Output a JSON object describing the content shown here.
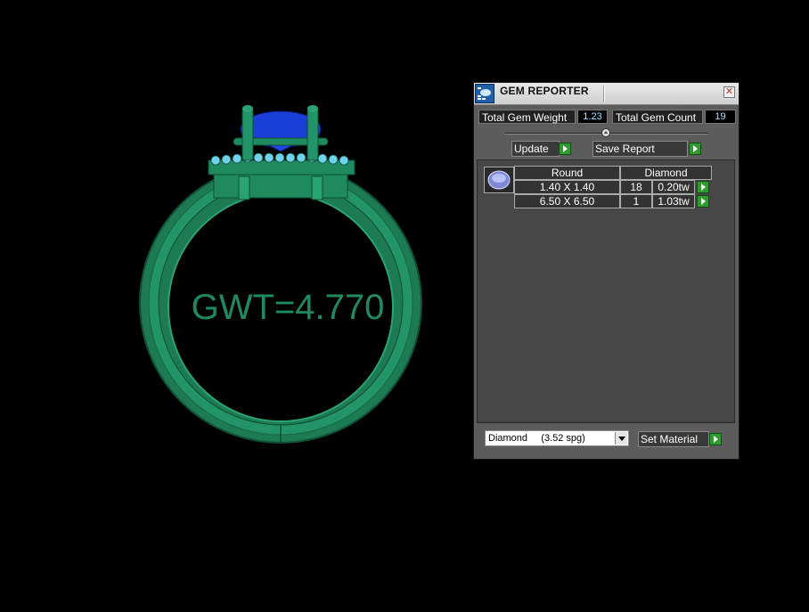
{
  "viewport": {
    "gwt_text": "GWT=4.770",
    "ring_color": "#1f8a60",
    "stone_color": "#1a3fd6",
    "accent_stone_color": "#6fd3f0"
  },
  "panel": {
    "title": "GEM REPORTER",
    "close_icon": "close-icon",
    "total_gem_weight_label": "Total Gem Weight",
    "total_gem_weight_value": "1.23",
    "total_gem_count_label": "Total Gem Count",
    "total_gem_count_value": "19",
    "update_label": "Update",
    "save_report_label": "Save Report",
    "table": {
      "shape_header": "Round",
      "material_header": "Diamond",
      "rows": [
        {
          "size": "1.40 X 1.40",
          "count": "18",
          "weight": "0.20tw"
        },
        {
          "size": "6.50 X 6.50",
          "count": "1",
          "weight": "1.03tw"
        }
      ]
    },
    "material_select_value": "Diamond     (3.52 spg)",
    "set_material_label": "Set Material"
  }
}
